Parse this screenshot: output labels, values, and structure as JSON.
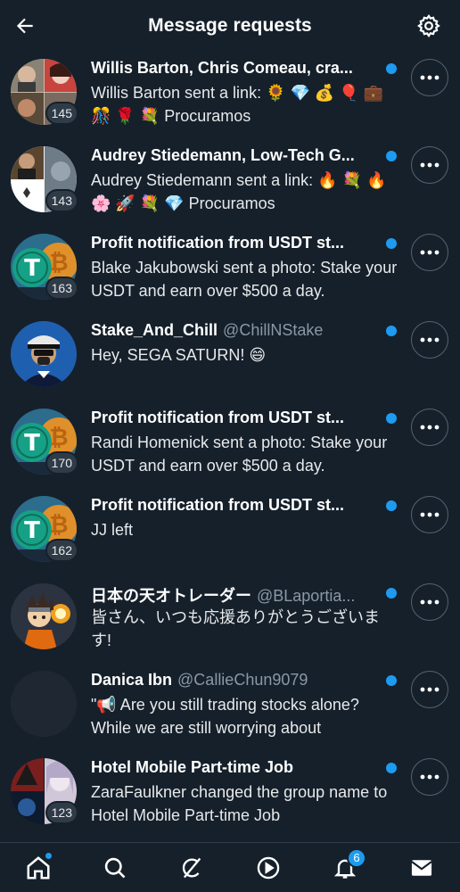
{
  "header": {
    "title": "Message requests"
  },
  "colors": {
    "background": "#15202b",
    "accent": "#1d9bf0",
    "secondary_text": "#8b98a5"
  },
  "requests": [
    {
      "name": "Willis Barton, Chris Comeau, cra...",
      "handle": "",
      "preview": "Willis Barton sent a link: 🌻 💎 💰 🎈 💼 🎊 🌹 💐 Procuramos",
      "count": "145",
      "avatar": "group-faces",
      "unread": true
    },
    {
      "name": "Audrey Stiedemann, Low-Tech G...",
      "handle": "",
      "preview": "Audrey Stiedemann sent a link: 🔥 💐 🔥 🌸 🚀 💐 💎 Procuramos",
      "count": "143",
      "avatar": "group-mixed",
      "unread": true
    },
    {
      "name": "Profit notification from USDT st...",
      "handle": "",
      "preview": "Blake Jakubowski sent a photo: Stake your USDT and earn over $500 a day.",
      "count": "163",
      "avatar": "crypto-coins",
      "unread": true
    },
    {
      "name": "Stake_And_Chill",
      "handle": "@ChillNStake",
      "preview": "Hey, SEGA SATURN! 😄",
      "count": "",
      "avatar": "captain-cartoon",
      "unread": true
    },
    {
      "name": "Profit notification from USDT st...",
      "handle": "",
      "preview": "Randi Homenick sent a photo: Stake your USDT and earn over $500 a day.",
      "count": "170",
      "avatar": "crypto-coins",
      "unread": true
    },
    {
      "name": "Profit notification from USDT st...",
      "handle": "",
      "preview": "JJ left",
      "count": "162",
      "avatar": "crypto-coins",
      "unread": true
    },
    {
      "name": "日本の天オトレーダー",
      "handle": "@BLaportia...",
      "preview": "皆さん、いつも応援ありがとうございます!",
      "count": "",
      "avatar": "ninja-cartoon",
      "unread": true
    },
    {
      "name": "Danica Ibn",
      "handle": "@CallieChun9079",
      "preview": "\"📢 Are you still trading stocks alone? While we are still worrying about",
      "count": "",
      "avatar": "blank",
      "unread": true
    },
    {
      "name": "Hotel Mobile Part-time Job",
      "handle": "",
      "preview": "ZaraFaulkner changed the group name to Hotel Mobile Part-time Job",
      "count": "123",
      "avatar": "group-art",
      "unread": true
    }
  ],
  "nav": {
    "items": [
      "home-icon",
      "search-icon",
      "grok-icon",
      "video-icon",
      "notifications-icon",
      "messages-icon"
    ],
    "notifications_badge": "6"
  }
}
